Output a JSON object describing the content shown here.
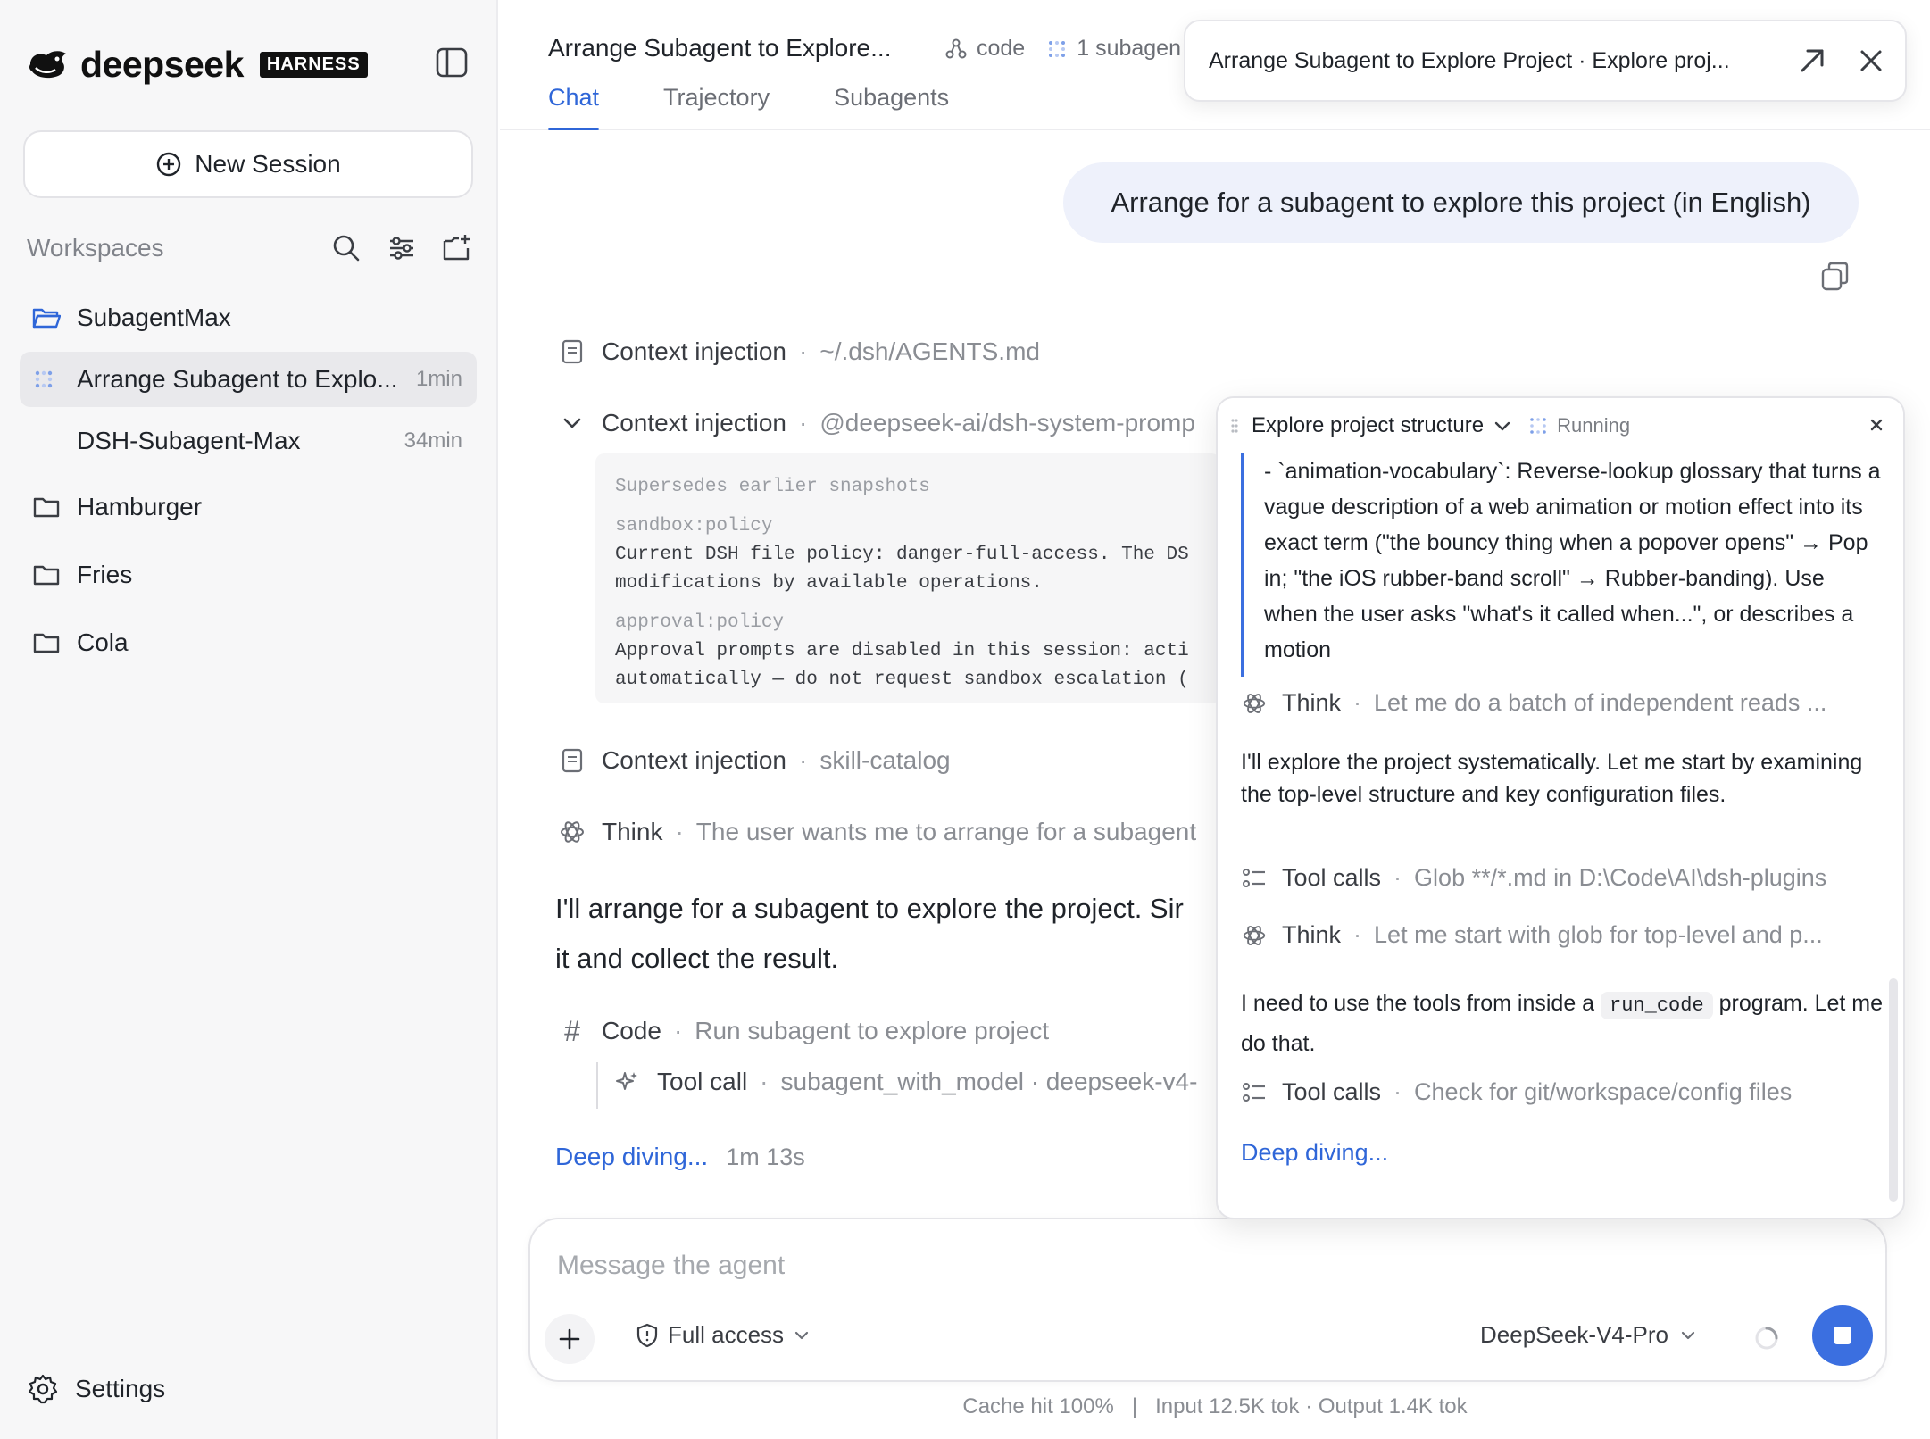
{
  "brand": {
    "name": "deepseek",
    "badge": "HARNESS"
  },
  "sidebar": {
    "new_session_label": "New Session",
    "workspaces_label": "Workspaces",
    "workspaces": [
      {
        "label": "SubagentMax",
        "open": true,
        "sessions": [
          {
            "label": "Arrange Subagent to Explo...",
            "age": "1min",
            "active": true
          },
          {
            "label": "DSH-Subagent-Max",
            "age": "34min",
            "active": false
          }
        ]
      },
      {
        "label": "Hamburger"
      },
      {
        "label": "Fries"
      },
      {
        "label": "Cola"
      }
    ],
    "settings_label": "Settings"
  },
  "header": {
    "title": "Arrange Subagent to Explore...",
    "meta_code": "code",
    "meta_subagents": "1 subagen",
    "tabs": [
      {
        "label": "Chat",
        "active": true
      },
      {
        "label": "Trajectory",
        "active": false
      },
      {
        "label": "Subagents",
        "active": false
      }
    ],
    "popout_title": "Arrange Subagent to Explore Project · Explore proj..."
  },
  "chat": {
    "user_message": "Arrange for a subagent to explore this project (in English)",
    "steps": [
      {
        "label": "Context injection",
        "detail": "~/.dsh/AGENTS.md"
      },
      {
        "label": "Context injection",
        "detail": "@deepseek-ai/dsh-system-promp"
      },
      {
        "label": "Context injection",
        "detail": "skill-catalog"
      },
      {
        "label": "Think",
        "detail": "The user wants me to arrange for a subagent"
      },
      {
        "label": "Code",
        "detail": "Run subagent to explore project"
      },
      {
        "label": "Tool call",
        "detail": "subagent_with_model · deepseek-v4-"
      }
    ],
    "context_block": {
      "supersedes": "Supersedes earlier snapshots",
      "sandbox_key": "sandbox:policy",
      "sandbox_line1": "Current DSH file policy: danger-full-access. The DS",
      "sandbox_line2": "modifications by available operations.",
      "approval_key": "approval:policy",
      "approval_line1": "Approval prompts are disabled in this session: acti",
      "approval_line2": "automatically — do not request sandbox escalation ("
    },
    "assistant_line1": "I'll arrange for a subagent to explore the project. Sir",
    "assistant_line2": "it and collect the result.",
    "deep_diving": "Deep diving...",
    "elapsed": "1m 13s"
  },
  "subagent_panel": {
    "title": "Explore project structure",
    "status": "Running",
    "quote": "- `animation-vocabulary`: Reverse-lookup glossary that turns a vague description of a web animation or motion effect into its exact term (\"the bouncy thing when a popover opens\" → Pop in; \"the iOS rubber-band scroll\" → Rubber-banding). Use when the user asks \"what's it called when...\", or describes a motion",
    "steps": [
      {
        "label": "Think",
        "detail": "Let me do a batch of independent reads ..."
      },
      {
        "label": "Tool calls",
        "detail": "Glob **/*.md in D:\\Code\\AI\\dsh-plugins"
      },
      {
        "label": "Think",
        "detail": "Let me start with glob for top-level and p..."
      },
      {
        "label": "Tool calls",
        "detail": "Check for git/workspace/config files"
      }
    ],
    "para1": "I'll explore the project systematically. Let me start by examining the top-level structure and key configuration files.",
    "para2_before": "I need to use the tools from inside a",
    "para2_code": "run_code",
    "para2_after": "program. Let me do that.",
    "deep_diving": "Deep diving..."
  },
  "composer": {
    "placeholder": "Message the agent",
    "access_label": "Full access",
    "model_label": "DeepSeek-V4-Pro"
  },
  "footer": {
    "cache": "Cache hit 100%",
    "separator": "|",
    "tokens": "Input 12.5K tok · Output 1.4K tok"
  },
  "colors": {
    "accent": "#2f66d8",
    "bubble": "#eef1fb",
    "sidebar_bg": "#f7f7f8"
  }
}
